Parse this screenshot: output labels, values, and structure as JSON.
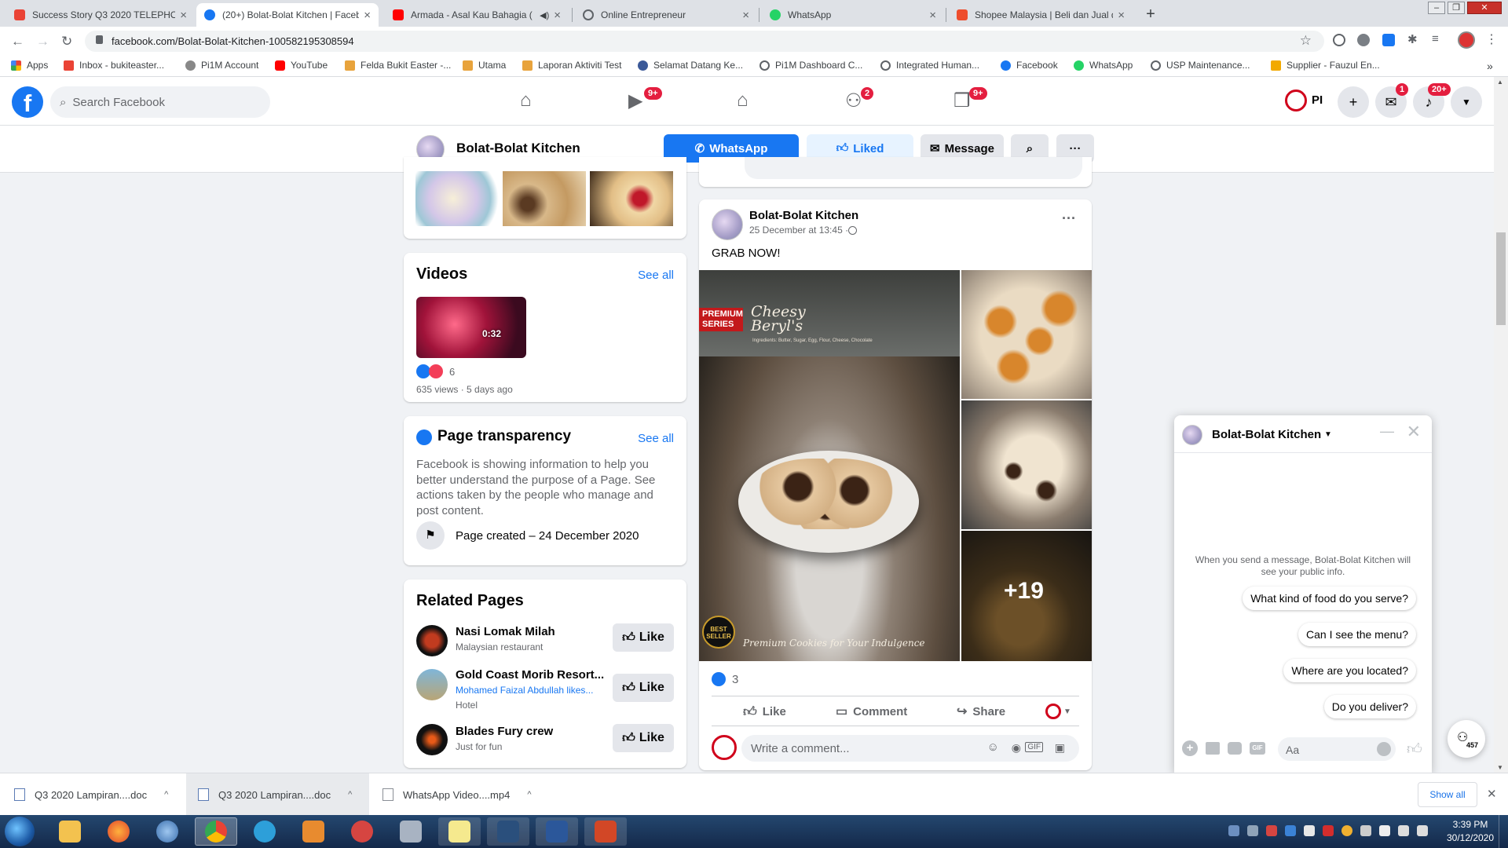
{
  "browser": {
    "tabs": [
      {
        "label": "Success Story Q3 2020 TELEPHON",
        "icon": "gmail-icon",
        "color": "#ea4335"
      },
      {
        "label": "(20+) Bolat-Bolat Kitchen | Faceb",
        "icon": "facebook-icon",
        "color": "#1877f2"
      },
      {
        "label": "Armada - Asal Kau Bahagia (",
        "icon": "youtube-icon",
        "color": "#ff0000"
      },
      {
        "label": "Online Entrepreneur",
        "icon": "globe-icon",
        "color": "#5f6368"
      },
      {
        "label": "WhatsApp",
        "icon": "whatsapp-icon",
        "color": "#25d366"
      },
      {
        "label": "Shopee Malaysia | Beli dan Jual d",
        "icon": "shopee-icon",
        "color": "#ee4d2d"
      }
    ],
    "new_tab": "+",
    "close_glyph": "×",
    "url": "facebook.com/Bolat-Bolat-Kitchen-100582195308594",
    "bookmarks": [
      {
        "label": "Apps",
        "color": "#ea4335"
      },
      {
        "label": "Inbox - bukiteaster...",
        "color": "#ea4335"
      },
      {
        "label": "Pi1M Account",
        "color": "#888888"
      },
      {
        "label": "YouTube",
        "color": "#ff0000"
      },
      {
        "label": "Felda Bukit Easter -...",
        "color": "#e8a33c"
      },
      {
        "label": "Utama",
        "color": "#e8a33c"
      },
      {
        "label": "Laporan Aktiviti Test",
        "color": "#e8a33c"
      },
      {
        "label": "Selamat Datang Ke...",
        "color": "#3b5998"
      },
      {
        "label": "Pi1M Dashboard C...",
        "color": "#5f6368"
      },
      {
        "label": "Integrated Human...",
        "color": "#5f6368"
      },
      {
        "label": "Facebook",
        "color": "#1877f2"
      },
      {
        "label": "WhatsApp",
        "color": "#25d366"
      },
      {
        "label": "USP Maintenance...",
        "color": "#5f6368"
      },
      {
        "label": "Supplier - Fauzul En...",
        "color": "#f2a900"
      }
    ],
    "bookmarks_more": "»"
  },
  "fb_header": {
    "logo": "f",
    "search_placeholder": "Search Facebook",
    "badges": {
      "watch": "9+",
      "groups": "2",
      "gaming": "9+",
      "messenger": "1",
      "notifications": "20+"
    },
    "profile_label": "PI"
  },
  "page_bar": {
    "name": "Bolat-Bolat Kitchen",
    "whatsapp_label": "WhatsApp",
    "liked_label": "Liked",
    "message_label": "Message",
    "more_label": "···"
  },
  "videos": {
    "title": "Videos",
    "see_all": "See all",
    "duration": "0:32",
    "reactions_count": "6",
    "meta": "635 views · 5 days ago"
  },
  "transparency": {
    "title": "Page transparency",
    "see_all": "See all",
    "text": "Facebook is showing information to help you better understand the purpose of a Page. See actions taken by the people who manage and post content.",
    "created": "Page created – 24 December 2020"
  },
  "related": {
    "title": "Related Pages",
    "like_label": "Like",
    "items": [
      {
        "name": "Nasi Lomak Milah",
        "sub": "Malaysian restaurant",
        "extra": ""
      },
      {
        "name": "Gold Coast Morib Resort...",
        "sub": "Mohamed Faizal Abdullah likes...",
        "extra": "Hotel"
      },
      {
        "name": "Blades Fury crew",
        "sub": "Just for fun",
        "extra": ""
      }
    ]
  },
  "post": {
    "author": "Bolat-Bolat Kitchen",
    "time": "25 December at 13:45 · ",
    "text": "GRAB NOW!",
    "more_photos": "+19",
    "photo_texts": {
      "premium": "PREMIUM SERIES",
      "product": "Cheesy Beryl's",
      "ingredients": "Ingredients: Butter, Sugar, Egg, Flour, Cheese, Chocolate",
      "tagline": "Premium Cookies for Your Indulgence",
      "best_seller": "BEST SELLER"
    },
    "likes": "3",
    "actions": {
      "like": "Like",
      "comment": "Comment",
      "share": "Share"
    },
    "comment_placeholder": "Write a comment...",
    "menu": "···"
  },
  "chat": {
    "name": "Bolat-Bolat Kitchen",
    "notice": "When you send a message, Bolat-Bolat Kitchen will see your public info.",
    "suggestions": [
      "What kind of food do you serve?",
      "Can I see the menu?",
      "Where are you located?",
      "Do you deliver?"
    ],
    "input_placeholder": "Aa",
    "contacts_count": "457"
  },
  "downloads": {
    "items": [
      "Q3 2020 Lampiran....doc",
      "Q3 2020 Lampiran....doc",
      "WhatsApp Video....mp4"
    ],
    "show_all": "Show all"
  },
  "taskbar": {
    "time": "3:39 PM",
    "date": "30/12/2020"
  }
}
